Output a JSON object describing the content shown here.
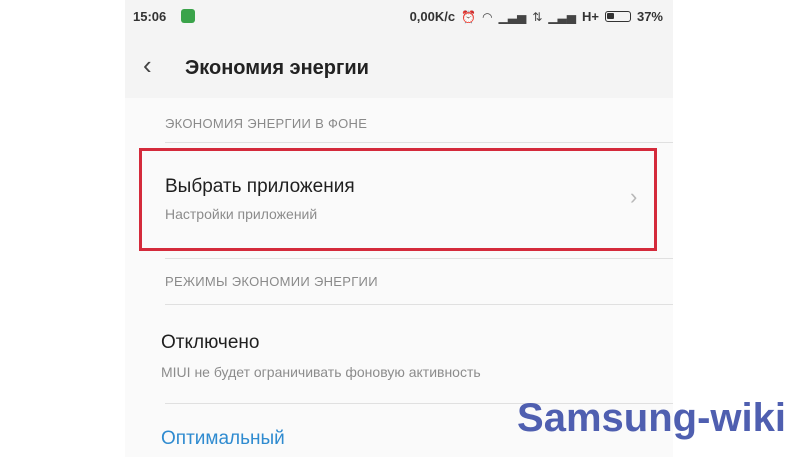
{
  "status_bar": {
    "time": "15:06",
    "network_speed": "0,00K/c",
    "network_type": "H+",
    "battery": "37%"
  },
  "app_bar": {
    "title": "Экономия энергии"
  },
  "sections": [
    {
      "header": "ЭКОНОМИЯ ЭНЕРГИИ В ФОНЕ",
      "items": [
        {
          "title": "Выбрать приложения",
          "subtitle": "Настройки приложений"
        }
      ]
    },
    {
      "header": "РЕЖИМЫ ЭКОНОМИИ ЭНЕРГИИ",
      "items": [
        {
          "title": "Отключено",
          "subtitle": "MIUI не будет ограничивать фоновую активность"
        },
        {
          "title": "Оптимальный"
        }
      ]
    }
  ],
  "watermark": "Samsung-wiki",
  "colors": {
    "highlight": "#d42a3b",
    "accent_blue": "#2f8bd0",
    "watermark": "#4f5fb0"
  }
}
